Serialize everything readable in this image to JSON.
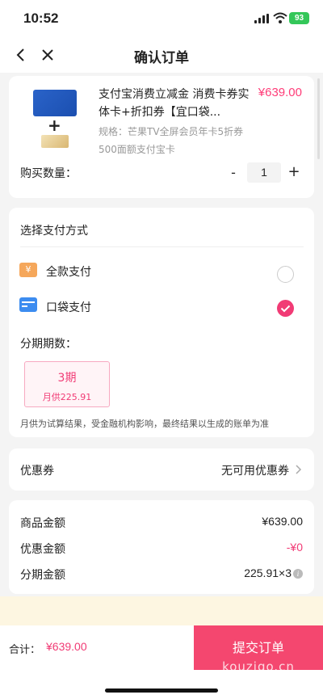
{
  "status": {
    "time": "10:52",
    "battery": "93"
  },
  "nav": {
    "title": "确认订单"
  },
  "product": {
    "title": "支付宝消费立减金 消费卡券实体卡+折扣券【宜口袋...",
    "price": "¥639.00",
    "spec": "规格：芒果TV全屏会员年卡5折券 500面额支付宝卡",
    "plus": "+",
    "qty_label": "购买数量：",
    "qty_minus": "-",
    "qty_value": "1",
    "qty_plus": "+"
  },
  "payment": {
    "header": "选择支付方式",
    "full_icon": "¥",
    "options": [
      {
        "label": "全款支付",
        "selected": false
      },
      {
        "label": "口袋支付",
        "selected": true
      }
    ],
    "installment_label": "分期期数：",
    "installment": {
      "period": "3期",
      "monthly": "月供225.91"
    },
    "note": "月供为试算结果，受金融机构影响，最终结果以生成的账单为准"
  },
  "coupon": {
    "label": "优惠券",
    "value": "无可用优惠券"
  },
  "amounts": [
    {
      "label": "商品金额",
      "value": "¥639.00"
    },
    {
      "label": "优惠金额",
      "value": "-¥0"
    },
    {
      "label": "分期金额",
      "value": "225.91×3"
    }
  ],
  "footer": {
    "total_label": "合计：",
    "total_value": "¥639.00",
    "submit": "提交订单",
    "watermark": "kouzigo.cn"
  },
  "colors": {
    "accent": "#f13b75",
    "submit": "#f4476f",
    "notice": "#fdf6e1"
  }
}
